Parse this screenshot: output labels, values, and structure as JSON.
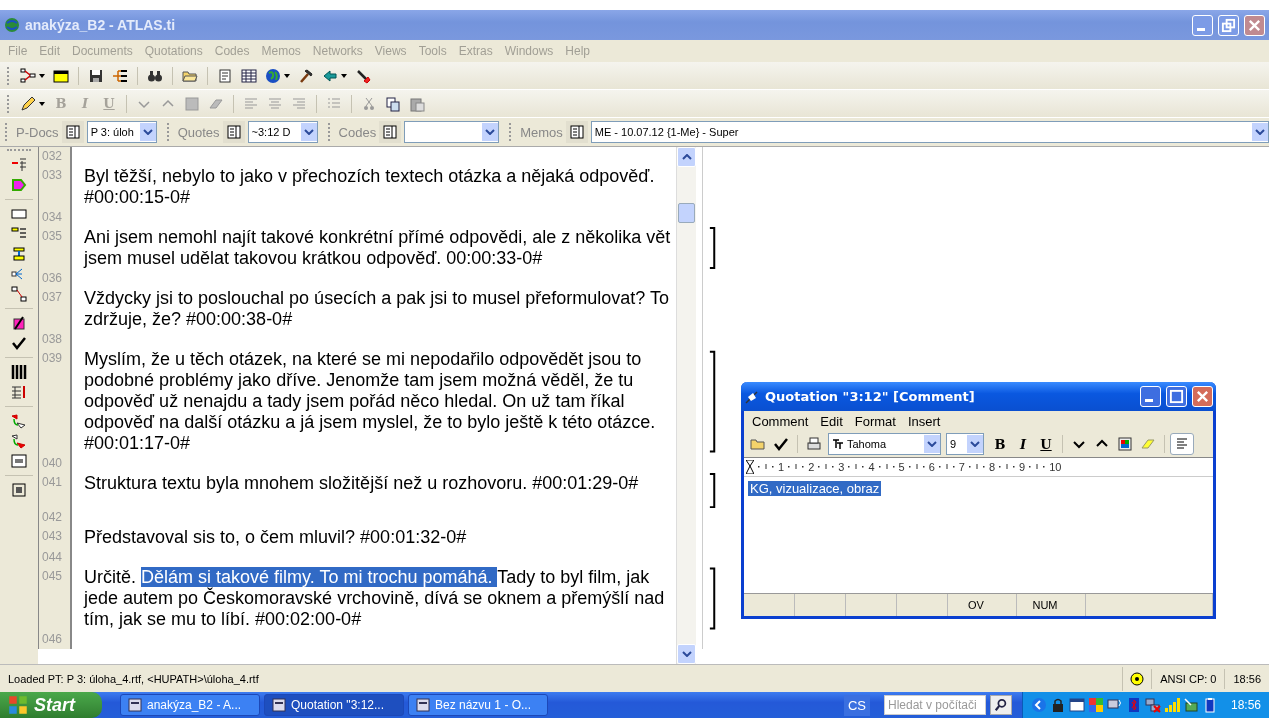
{
  "window": {
    "title": "anakýza_B2 - ATLAS.ti",
    "active": false
  },
  "menu": [
    "File",
    "Edit",
    "Documents",
    "Quotations",
    "Codes",
    "Memos",
    "Networks",
    "Views",
    "Tools",
    "Extras",
    "Windows",
    "Help"
  ],
  "format_toolbar": {
    "disabled": true,
    "text_buttons": [
      "B",
      "I",
      "U"
    ]
  },
  "selectors": [
    {
      "label": "P-Docs",
      "value": "P 3: úloh"
    },
    {
      "label": "Quotes",
      "value": "~3:12 D"
    },
    {
      "label": "Codes"
    },
    {
      "label": "Memos",
      "value": "ME - 10.07.12 {1-Me} - Super"
    }
  ],
  "document": {
    "lines": [
      {
        "number": "032"
      },
      {
        "number": "033",
        "quoted": false,
        "segments": [
          {
            "text": "Byl těžší, nebylo to jako v přechozích textech otázka a nějaká odpověď. #00:00:15-0#",
            "selected": false
          }
        ]
      },
      {
        "number": "034"
      },
      {
        "number": "035",
        "quoted": true,
        "segments": [
          {
            "text": "Ani jsem nemohl najít takové konkrétní přímé odpovědi, ale z několika vět jsem musel udělat takovou krátkou odpověď. 00:00:33-0#",
            "selected": false
          }
        ]
      },
      {
        "number": "036"
      },
      {
        "number": "037",
        "quoted": false,
        "segments": [
          {
            "text": "Vždycky jsi to poslouchal po úsecích a pak jsi to musel přeformulovat? To zdržuje, že?  #00:00:38-0#",
            "selected": false
          }
        ]
      },
      {
        "number": "038"
      },
      {
        "number": "039",
        "quoted": true,
        "segments": [
          {
            "text": "Myslím, že u těch otázek, na které se mi nepodařilo odpovědět jsou to podobné problémy jako dříve. Jenomže tam jsem možná věděl, že tu odpověď už nenajdu a tady jsem pořád něco hledal. On už tam říkal odpověď na další otázku a já jsem myslel, že to bylo ještě k této otázce. #00:01:17-0#",
            "selected": false
          }
        ]
      },
      {
        "number": "040"
      },
      {
        "number": "041",
        "quoted": true,
        "segments": [
          {
            "text": "Struktura textu byla mnohem složitější než u rozhovoru.  #00:01:29-0#",
            "selected": false
          }
        ]
      },
      {
        "number": "042"
      },
      {
        "number": "043",
        "quoted": false,
        "segments": [
          {
            "text": "Představoval sis to, o čem mluvil?  #00:01:32-0#",
            "selected": false
          }
        ]
      },
      {
        "number": "044"
      },
      {
        "number": "045",
        "quoted": true,
        "segments": [
          {
            "text": "Určitě. ",
            "selected": false
          },
          {
            "text": "Dělám si takové filmy. To mi trochu pomáhá. ",
            "selected": true
          },
          {
            "text": "Tady to byl film, jak jede autem po Českomoravské vrchovině, dívá se oknem a přemýšlí nad tím, jak se mu to líbí. #00:02:00-0#",
            "selected": false
          }
        ]
      },
      {
        "number": "046"
      }
    ]
  },
  "comment_window": {
    "title": "Quotation \"3:12\" [Comment]",
    "active": true,
    "menu": [
      "Comment",
      "Edit",
      "Format",
      "Insert"
    ],
    "font": "Tahoma",
    "size": "9",
    "text_buttons": [
      "B",
      "I",
      "U"
    ],
    "ruler": [
      "1",
      "2",
      "3",
      "4",
      "5",
      "6",
      "7",
      "8",
      "9",
      "10"
    ],
    "text": "KG, vizualizace, obraz",
    "text_selected": true,
    "status_panes": [
      "OV",
      "NUM"
    ]
  },
  "status_bar": {
    "message": "Loaded PT: P 3: úloha_4.rtf, <HUPATH>\\úloha_4.rtf",
    "encoding": "ANSI CP: 0",
    "time": "18:56"
  },
  "taskbar": {
    "start": "Start",
    "tasks": [
      {
        "label": "anakýza_B2 - A...",
        "selected": false
      },
      {
        "label": "Quotation \"3:12...",
        "selected": true
      },
      {
        "label": "Bez názvu 1 - O...",
        "selected": false
      }
    ],
    "language": "CS",
    "search": {
      "placeholder": "Hledat v počítači"
    },
    "time": "18:56"
  }
}
